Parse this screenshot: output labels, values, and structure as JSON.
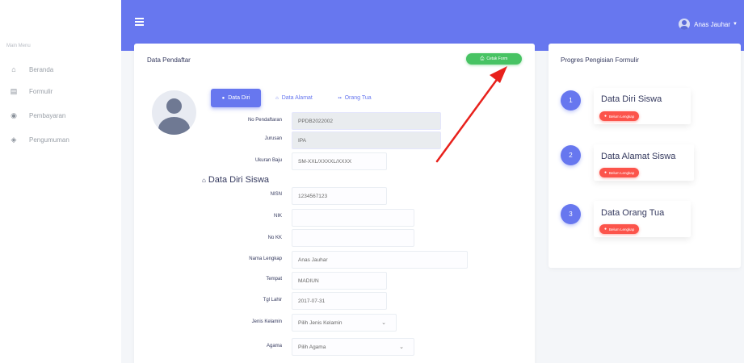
{
  "sidebar": {
    "menu_label": "Main Menu",
    "items": [
      {
        "icon": "home-icon",
        "glyph": "⌂",
        "label": "Beranda"
      },
      {
        "icon": "form-icon",
        "glyph": "▤",
        "label": "Formulir"
      },
      {
        "icon": "payment-icon",
        "glyph": "◉",
        "label": "Pembayaran"
      },
      {
        "icon": "announcement-icon",
        "glyph": "◈",
        "label": "Pengumuman"
      }
    ]
  },
  "navbar": {
    "user_name": "Anas Jauhar",
    "accent_color": "#6777ef"
  },
  "main_card": {
    "title": "Data Pendaftar",
    "print_button": "Cetak Form",
    "tabs": [
      "Data Diri",
      "Data Alamat",
      "Orang Tua"
    ],
    "form": {
      "no_pendaftaran_label": "No Pendaftaran",
      "no_pendaftaran_value": "PPDB2022002",
      "jurusan_label": "Jurusan",
      "jurusan_value": "IPA",
      "ukuran_baju_label": "Ukuran Baju",
      "ukuran_baju_value": "SM-XXL/XXXXL/XXXX",
      "section_title": "Data Diri Siswa",
      "nisn_label": "NISN",
      "nisn_value": "1234567123",
      "nik_label": "NIK",
      "nik_value": "",
      "no_kk_label": "No KK",
      "no_kk_value": "",
      "nama_label": "Nama Lengkap",
      "nama_value": "Anas Jauhar",
      "tempat_label": "Tempat",
      "tempat_value": "MADIUN",
      "tgl_lahir_label": "Tgl Lahir",
      "tgl_lahir_value": "2017-07-31",
      "jk_label": "Jenis Kelamin",
      "jk_value": "Pilih Jenis Kelamin",
      "agama_label": "Agama",
      "agama_value": "Pilih Agama"
    }
  },
  "progress_card": {
    "title": "Progres Pengisian Formulir",
    "steps": [
      {
        "num": "1",
        "title": "Data Diri Siswa",
        "status": "Belum Lengkap"
      },
      {
        "num": "2",
        "title": "Data Alamat Siswa",
        "status": "Belum Lengkap"
      },
      {
        "num": "3",
        "title": "Data Orang Tua",
        "status": "Belum Lengkap"
      }
    ]
  },
  "colors": {
    "primary": "#6777ef",
    "success": "#47c363",
    "danger": "#fc544b",
    "annotation_arrow": "#e8211c"
  }
}
